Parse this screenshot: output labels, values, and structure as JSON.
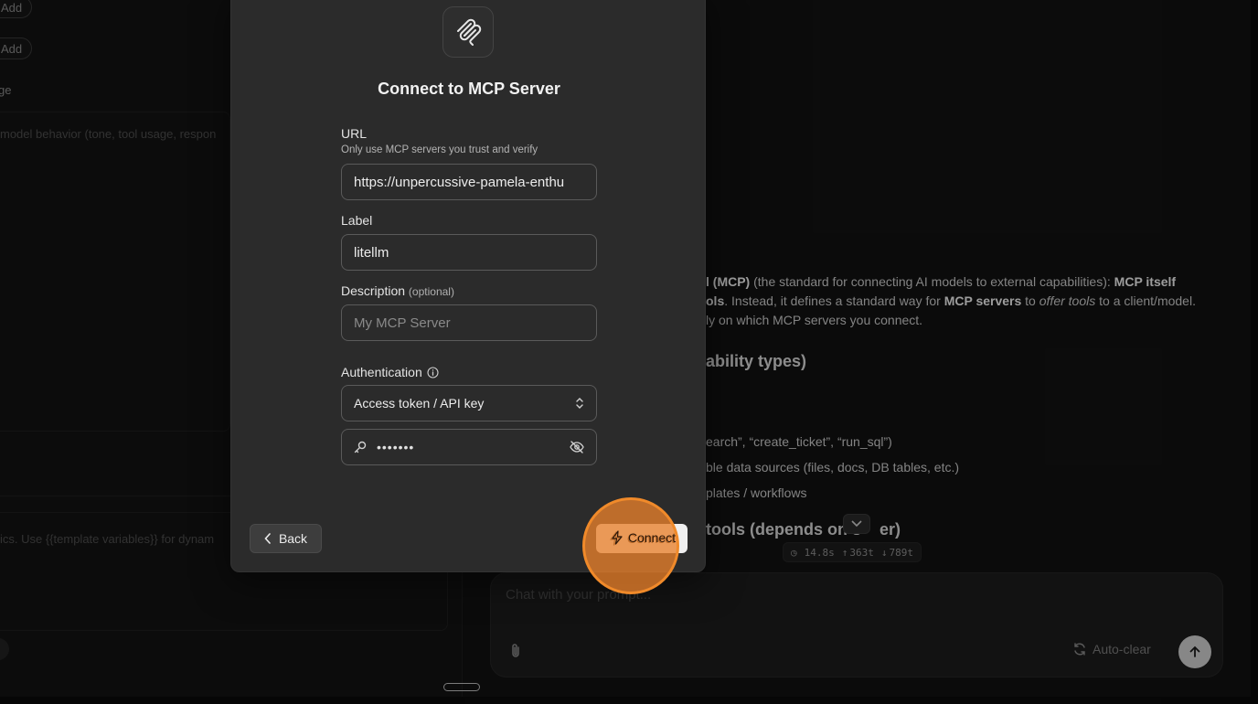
{
  "background": {
    "left_panel": {
      "add_buttons": [
        "Add",
        "Add"
      ],
      "section_label": "ge",
      "system_prompt_placeholder": "model behavior (tone, tool usage, respon",
      "template_hint": "ics. Use {{template variables}} for dynam"
    },
    "chat": {
      "line1_a": "l (MCP)",
      "line1_b": " (the standard for connecting AI models to external capabilities): ",
      "line1_c": "MCP itself",
      "line2_a": "ols",
      "line2_b": ". Instead, it defines a standard way for ",
      "line2_c": "MCP servers",
      "line2_d": " to ",
      "line2_e": "offer tools",
      "line2_f": " to a client/model.",
      "line3": "ly on which MCP servers you connect.",
      "heading1": "ability types)",
      "bullet1": "earch”, “create_ticket”, “run_sql”)",
      "bullet2": "ble data sources (files, docs, DB tables, etc.)",
      "bullet3": "plates / workflows",
      "heading2_a": "tools (depends on s",
      "heading2_b": "er)",
      "stats": {
        "time": "14.8s",
        "tokens_up": "363t",
        "tokens_down": "789t"
      },
      "composer": {
        "placeholder": "Chat with your prompt...",
        "autoclear_label": "Auto-clear"
      }
    }
  },
  "modal": {
    "title": "Connect to MCP Server",
    "url": {
      "label": "URL",
      "hint": "Only use MCP servers you trust and verify",
      "value": "https://unpercussive-pamela-enthu"
    },
    "label_field": {
      "label": "Label",
      "value": "litellm"
    },
    "description": {
      "label": "Description",
      "optional": "(optional)",
      "placeholder": "My MCP Server"
    },
    "authentication": {
      "label": "Authentication",
      "selected": "Access token / API key",
      "key_masked": "•••••••"
    },
    "back_label": "Back",
    "connect_label": "Connect"
  }
}
